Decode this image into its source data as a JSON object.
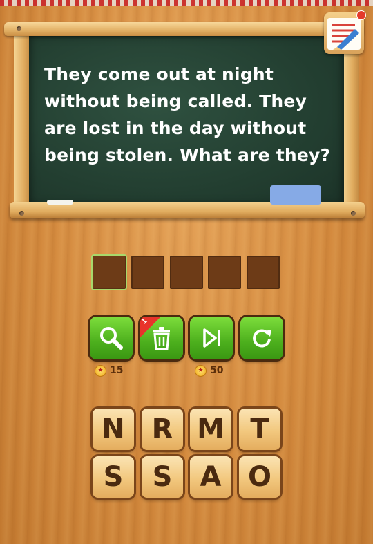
{
  "riddle": {
    "text": "They come out at night without being called. They are lost in the day without being stolen. What are they?"
  },
  "answer": {
    "length": 5,
    "slots": [
      "",
      "",
      "",
      "",
      ""
    ],
    "active_index": 0
  },
  "tools": [
    {
      "name": "hint",
      "icon": "magnifier-icon",
      "cost": "15"
    },
    {
      "name": "remove",
      "icon": "trash-icon",
      "badge": "1"
    },
    {
      "name": "skip",
      "icon": "skip-icon",
      "cost": "50"
    },
    {
      "name": "reset",
      "icon": "refresh-icon"
    }
  ],
  "letters": {
    "row1": [
      "N",
      "R",
      "M",
      "T"
    ],
    "row2": [
      "S",
      "S",
      "A",
      "O"
    ]
  },
  "icons": {
    "notepad": "notepad-pencil-icon",
    "coin": "coin-icon"
  },
  "colors": {
    "board": "#233f31",
    "tool_green": "#4caf1d",
    "slot_brown": "#6d3b17",
    "tile": "#f2c87e",
    "accent_blue": "#86aae6"
  }
}
